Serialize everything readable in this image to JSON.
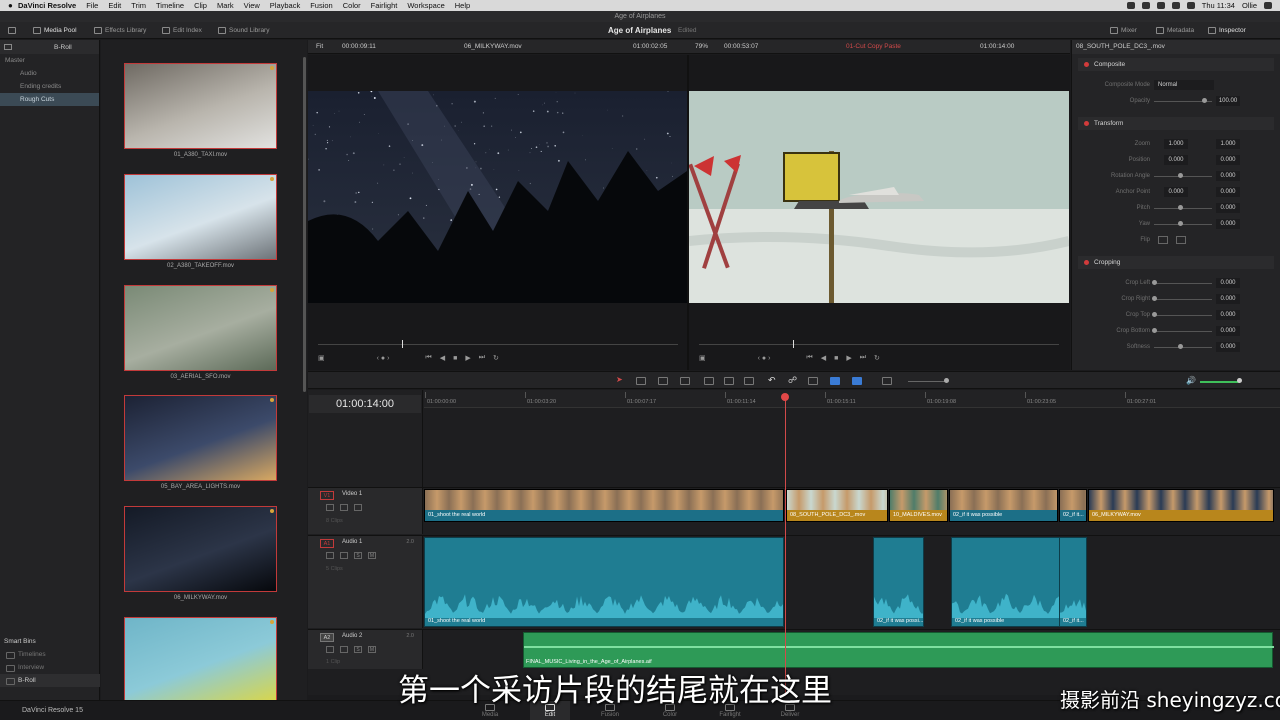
{
  "menubar": {
    "app_name": "DaVinci Resolve",
    "items": [
      "File",
      "Edit",
      "Trim",
      "Timeline",
      "Clip",
      "Mark",
      "View",
      "Playback",
      "Fusion",
      "Color",
      "Fairlight",
      "Workspace",
      "Help"
    ],
    "clock": "Thu 11:34",
    "user": "Ollie"
  },
  "window": {
    "title": "Age of Airplanes"
  },
  "toolbar": {
    "media_pool": "Media Pool",
    "effects_library": "Effects Library",
    "edit_index": "Edit Index",
    "sound_library": "Sound Library",
    "project_title": "Age of Airplanes",
    "project_status": "Edited",
    "mixer": "Mixer",
    "metadata": "Metadata",
    "inspector": "Inspector"
  },
  "bins": {
    "current": "B-Roll",
    "items": [
      {
        "label": "Master",
        "kind": "master"
      },
      {
        "label": "Audio",
        "kind": "child"
      },
      {
        "label": "Ending credits",
        "kind": "child"
      },
      {
        "label": "Rough Cuts",
        "kind": "child",
        "selected": true
      }
    ],
    "smart_bins_title": "Smart Bins",
    "smart_bins": [
      {
        "label": "Timelines"
      },
      {
        "label": "Interview"
      },
      {
        "label": "B-Roll",
        "selected": true
      }
    ]
  },
  "clips": [
    {
      "name": "01_A380_TAXI.mov",
      "colors": [
        "#6f6a63",
        "#b9b5ad",
        "#e2e2e0"
      ]
    },
    {
      "name": "02_A380_TAKEOFF.mov",
      "colors": [
        "#9ec2d8",
        "#d7e3ea",
        "#6d7378"
      ]
    },
    {
      "name": "03_AERIAL_SFO.mov",
      "colors": [
        "#7a8a76",
        "#a7aea0",
        "#5c6a58"
      ]
    },
    {
      "name": "05_BAY_AREA_LIGHTS.mov",
      "colors": [
        "#1c2234",
        "#3c4a6a",
        "#d8a862"
      ]
    },
    {
      "name": "06_MILKYWAY.mov",
      "colors": [
        "#141a26",
        "#2c3548",
        "#06080c"
      ]
    },
    {
      "name": "",
      "colors": [
        "#6fb5c8",
        "#8ccad8",
        "#d9d64a"
      ]
    }
  ],
  "viewer": {
    "fit": "Fit",
    "src_tc": "00:00:09:11",
    "src_clip": "06_MILKYWAY.mov",
    "src_dur": "01:00:02:05",
    "zoom": "79%",
    "tl_dur": "00:00:53:07",
    "tl_name": "01-Cut Copy Paste",
    "tl_tc": "01:00:14:00"
  },
  "inspector": {
    "clip": "08_SOUTH_POLE_DC3_.mov",
    "composite": {
      "title": "Composite",
      "mode_label": "Composite Mode",
      "mode_value": "Normal",
      "opacity_label": "Opacity",
      "opacity_value": "100.00"
    },
    "transform": {
      "title": "Transform",
      "zoom_label": "Zoom",
      "zoom_x": "1.000",
      "zoom_y": "1.000",
      "position_label": "Position",
      "pos_x": "0.000",
      "pos_y": "0.000",
      "rotation_label": "Rotation Angle",
      "rotation": "0.000",
      "anchor_label": "Anchor Point",
      "anchor_x": "0.000",
      "anchor_y": "0.000",
      "pitch_label": "Pitch",
      "pitch": "0.000",
      "yaw_label": "Yaw",
      "yaw": "0.000",
      "flip_label": "Flip"
    },
    "cropping": {
      "title": "Cropping",
      "left_label": "Crop Left",
      "left": "0.000",
      "right_label": "Crop Right",
      "right": "0.000",
      "top_label": "Crop Top",
      "top": "0.000",
      "bottom_label": "Crop Bottom",
      "bottom": "0.000",
      "soft_label": "Softness",
      "soft": "0.000"
    }
  },
  "timeline": {
    "timecode": "01:00:14:00",
    "ruler": [
      "01:00:00:00",
      "01:00:03:20",
      "01:00:07:17",
      "01:00:11:14",
      "01:00:15:11",
      "01:00:19:08",
      "01:00:23:05",
      "01:00:27:01"
    ],
    "v1": {
      "tag": "V1",
      "name": "Video 1",
      "count": "8 Clips"
    },
    "a1": {
      "tag": "A1",
      "name": "Audio 1",
      "chan": "2.0",
      "count": "5 Clips"
    },
    "a2": {
      "tag": "A2",
      "name": "Audio 2",
      "chan": "2.0",
      "count": "1 Clip"
    },
    "video_clips": [
      {
        "label": "01_shoot the real world",
        "color": "#1c6f87"
      },
      {
        "label": "08_SOUTH_POLE_DC3_.mov",
        "color": "#b8861c"
      },
      {
        "label": "10_MALDIVES.mov",
        "color": "#b8861c"
      },
      {
        "label": "02_if it was possible",
        "color": "#1c6f87"
      },
      {
        "label": "02_if it...",
        "color": "#1c6f87"
      },
      {
        "label": "06_MILKYWAY.mov",
        "color": "#b8861c"
      }
    ],
    "audio_clips": [
      {
        "label": "01_shoot the real world"
      },
      {
        "label": "02_if it was possi..."
      },
      {
        "label": "02_if it was possible"
      },
      {
        "label": "02_if it..."
      }
    ],
    "music_clip": "FINAL_MUSIC_Living_in_the_Age_of_Airplanes.aif"
  },
  "pages": [
    "Media",
    "Edit",
    "Fusion",
    "Color",
    "Fairlight",
    "Deliver"
  ],
  "current_page": "Edit",
  "brand": "DaVinci Resolve 15",
  "subtitle": "第一个采访片段的结尾就在这里",
  "watermark": "摄影前沿 sheyingzyz.com"
}
